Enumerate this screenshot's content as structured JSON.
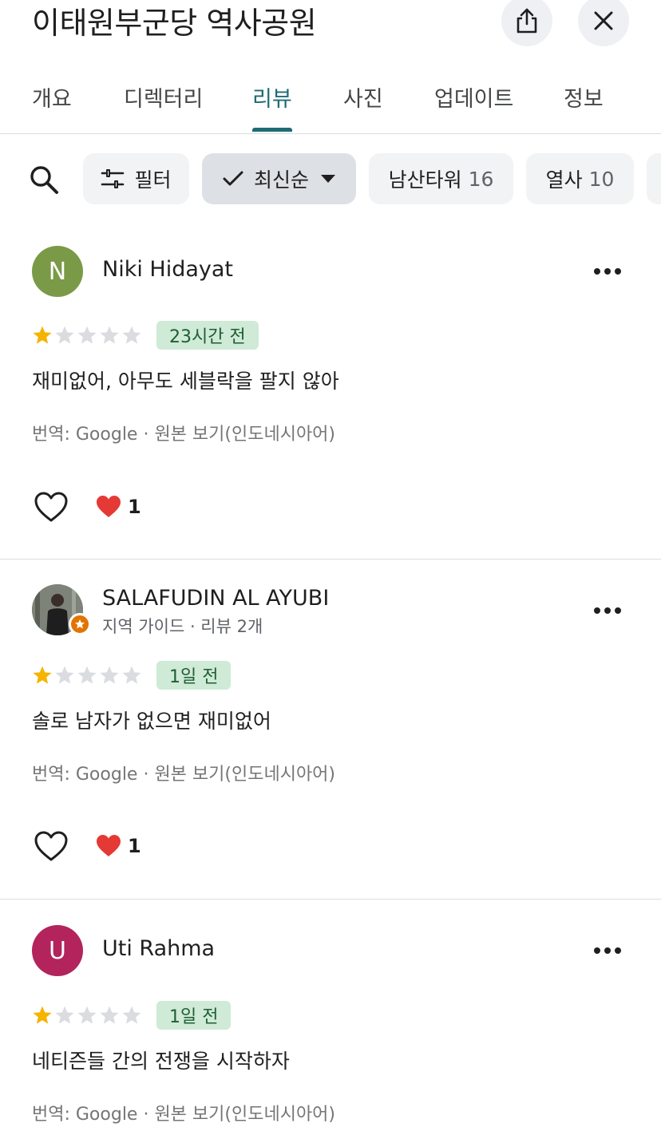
{
  "header": {
    "title": "이태원부군당 역사공원",
    "share_icon": "share-icon",
    "close_icon": "close-icon"
  },
  "tabs": [
    {
      "label": "개요",
      "active": false
    },
    {
      "label": "디렉터리",
      "active": false
    },
    {
      "label": "리뷰",
      "active": true
    },
    {
      "label": "사진",
      "active": false
    },
    {
      "label": "업데이트",
      "active": false
    },
    {
      "label": "정보",
      "active": false
    }
  ],
  "chips": {
    "search_icon": "search-icon",
    "filter": {
      "label": "필터",
      "icon": "sliders-icon"
    },
    "sort": {
      "label": "최신순",
      "icon": "check-icon",
      "dropdown_icon": "caret-down-icon"
    },
    "topics": [
      {
        "label": "남산타워",
        "count": "16"
      },
      {
        "label": "열사",
        "count": "10"
      }
    ]
  },
  "colors": {
    "accent": "#1f6b75",
    "star_filled": "#f4b400",
    "star_empty": "#dadce0",
    "time_badge_bg": "#cfead6",
    "time_badge_text": "#1e5e33"
  },
  "reviews": [
    {
      "avatar_letter": "N",
      "avatar_color": "#7a9a47",
      "name": "Niki Hidayat",
      "subtitle": "",
      "rating": 1,
      "time": "23시간 전",
      "text": "재미없어, 아무도 세블락을 팔지 않아",
      "translation": "번역: Google · 원본 보기(인도네시아어)",
      "reaction_count": "1"
    },
    {
      "avatar_letter": "",
      "avatar_color": "",
      "name": "SALAFUDIN AL AYUBI",
      "subtitle": "지역 가이드 · 리뷰 2개",
      "rating": 1,
      "time": "1일 전",
      "text": "솔로 남자가 없으면 재미없어",
      "translation": "번역: Google · 원본 보기(인도네시아어)",
      "reaction_count": "1"
    },
    {
      "avatar_letter": "U",
      "avatar_color": "#b3245c",
      "name": "Uti Rahma",
      "subtitle": "",
      "rating": 1,
      "time": "1일 전",
      "text": "네티즌들 간의 전쟁을 시작하자",
      "translation": "번역: Google · 원본 보기(인도네시아어)",
      "reaction_count": ""
    }
  ]
}
